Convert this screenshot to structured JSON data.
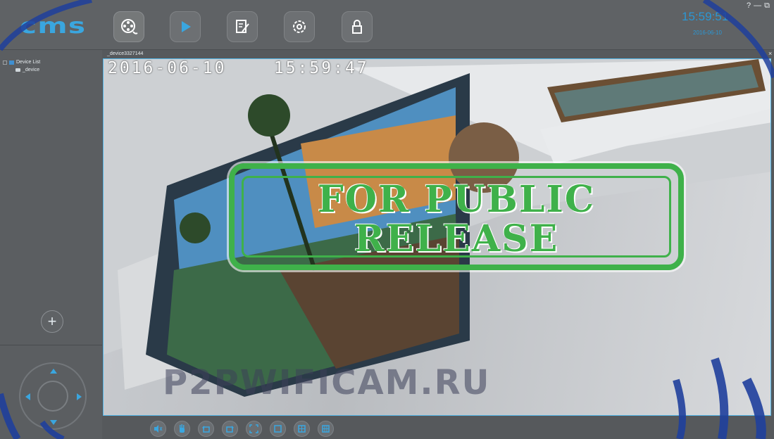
{
  "app": {
    "logo": "cms"
  },
  "nav": [
    {
      "icon": "film-reel-icon",
      "active": true
    },
    {
      "icon": "play-icon",
      "active": false
    },
    {
      "icon": "edit-icon",
      "active": false
    },
    {
      "icon": "gear-icon",
      "active": false
    },
    {
      "icon": "lock-icon",
      "active": false
    }
  ],
  "clock": {
    "time": "15:59:51",
    "date": "2016-06-10"
  },
  "window_controls": {
    "help": "?",
    "minimize": "—",
    "restore": "⧉"
  },
  "sidebar": {
    "tree_root": "Device List",
    "device": "_device"
  },
  "video": {
    "title": "_device3327144",
    "close": "×",
    "osd_text": "2016-06-10    15:59:47",
    "stamp_line1": "FOR PUBLIC",
    "stamp_line2": "RELEASE",
    "watermark": "P2PWIFICAM.RU"
  },
  "toolbar": [
    {
      "icon": "mute-icon"
    },
    {
      "icon": "hand-icon"
    },
    {
      "icon": "rotate-left-icon"
    },
    {
      "icon": "rotate-right-icon"
    },
    {
      "icon": "fullscreen-icon"
    },
    {
      "icon": "layout-1-icon"
    },
    {
      "icon": "layout-4-icon"
    },
    {
      "icon": "layout-more-icon"
    }
  ],
  "colors": {
    "accent": "#3aa6df",
    "stamp": "#3fb14a",
    "frame": "#53b6e8"
  }
}
